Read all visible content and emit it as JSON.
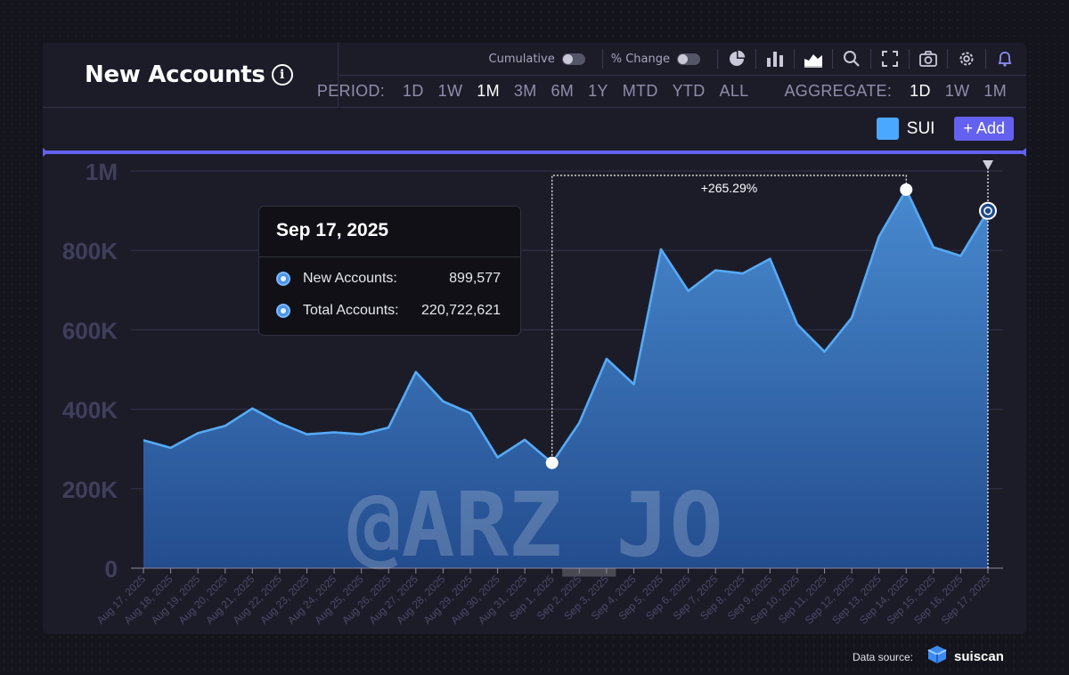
{
  "header": {
    "title": "New Accounts",
    "info_glyph": "i"
  },
  "toolbar": {
    "cumulative_label": "Cumulative",
    "pct_change_label": "% Change",
    "icons": [
      "pie-chart-icon",
      "bar-chart-icon",
      "area-chart-icon",
      "search-icon",
      "fullscreen-icon",
      "camera-icon",
      "gear-icon",
      "bell-icon"
    ]
  },
  "period": {
    "label": "PERIOD:",
    "options": [
      "1D",
      "1W",
      "1M",
      "3M",
      "6M",
      "1Y",
      "MTD",
      "YTD",
      "ALL"
    ],
    "active": "1M"
  },
  "aggregate": {
    "label": "AGGREGATE:",
    "options": [
      "1D",
      "1W",
      "1M"
    ],
    "active": "1D"
  },
  "legend": {
    "series_label": "SUI",
    "add_label": "+ Add"
  },
  "tooltip": {
    "date": "Sep 17, 2025",
    "rows": [
      {
        "label": "New Accounts:",
        "value": "899,577"
      },
      {
        "label": "Total Accounts:",
        "value": "220,722,621"
      }
    ]
  },
  "watermark": "@ARZ_JO",
  "footer": {
    "data_source_label": "Data source:",
    "brand": "suiscan"
  },
  "colors": {
    "accent": "#6461f0",
    "series": "#4ba8ff",
    "line": "#56aaf5",
    "background": "#1c1c29"
  },
  "chart_data": {
    "type": "area",
    "title": "New Accounts",
    "ylim": [
      0,
      1000000
    ],
    "yticks": [
      0,
      200000,
      400000,
      600000,
      800000,
      1000000
    ],
    "ytick_labels": [
      "0",
      "200K",
      "400K",
      "600K",
      "800K",
      "1M"
    ],
    "grid": true,
    "legend": "top-right",
    "categories": [
      "Aug 17, 2025",
      "Aug 18, 2025",
      "Aug 19, 2025",
      "Aug 20, 2025",
      "Aug 21, 2025",
      "Aug 22, 2025",
      "Aug 23, 2025",
      "Aug 24, 2025",
      "Aug 25, 2025",
      "Aug 26, 2025",
      "Aug 27, 2025",
      "Aug 28, 2025",
      "Aug 29, 2025",
      "Aug 30, 2025",
      "Aug 31, 2025",
      "Sep 1, 2025",
      "Sep 2, 2025",
      "Sep 3, 2025",
      "Sep 4, 2025",
      "Sep 5, 2025",
      "Sep 6, 2025",
      "Sep 7, 2025",
      "Sep 8, 2025",
      "Sep 9, 2025",
      "Sep 10, 2025",
      "Sep 11, 2025",
      "Sep 12, 2025",
      "Sep 13, 2025",
      "Sep 14, 2025",
      "Sep 15, 2025",
      "Sep 16, 2025",
      "Sep 17, 2025"
    ],
    "series": [
      {
        "name": "SUI",
        "values": [
          322000,
          303000,
          340000,
          358000,
          402000,
          365000,
          337000,
          342000,
          337000,
          354000,
          494000,
          420000,
          390000,
          279000,
          323000,
          265000,
          366000,
          527000,
          463000,
          803000,
          698000,
          750000,
          742000,
          779000,
          614000,
          545000,
          630000,
          835000,
          953000,
          808000,
          786000,
          899577
        ]
      }
    ],
    "annotation": {
      "label": "+265.29%",
      "from": "Sep 1, 2025",
      "to": "Sep 14, 2025"
    },
    "highlight": "Sep 17, 2025"
  }
}
